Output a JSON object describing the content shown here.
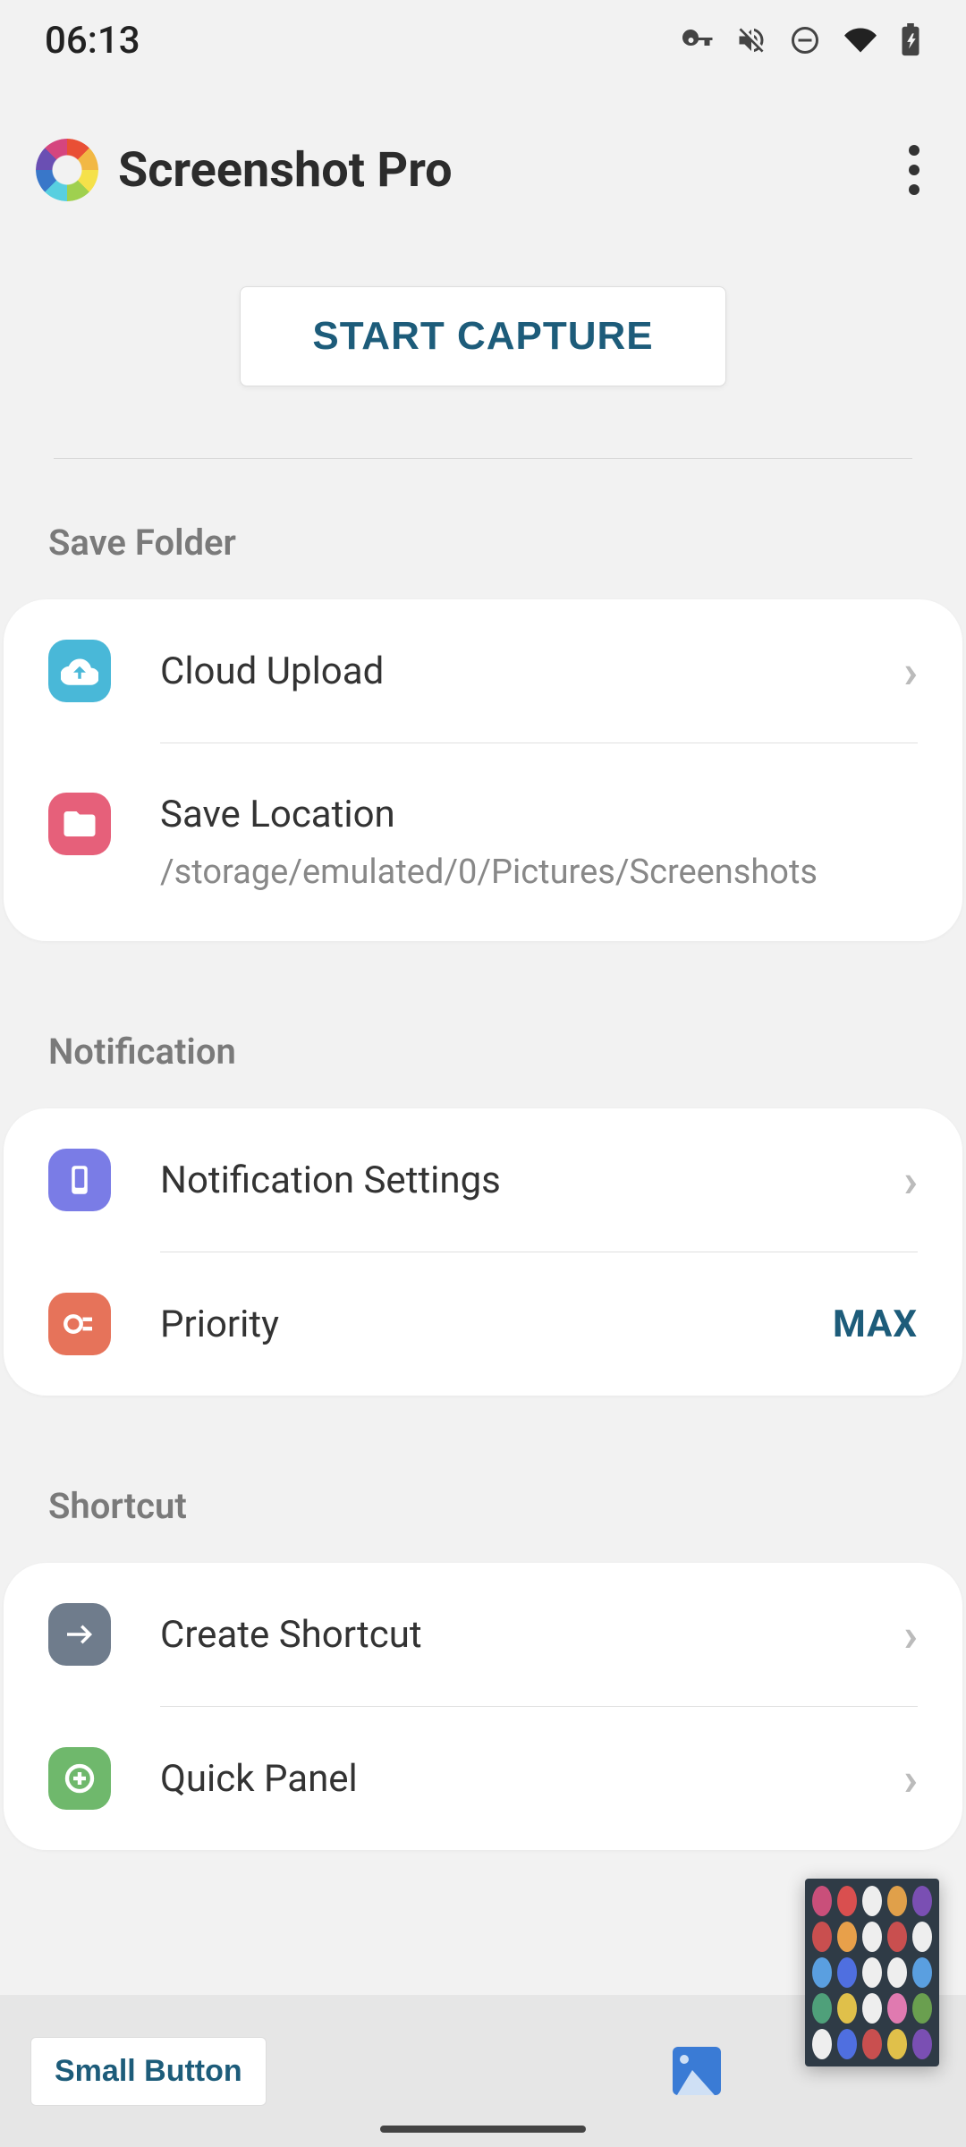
{
  "statusbar": {
    "time": "06:13"
  },
  "header": {
    "title": "Screenshot Pro"
  },
  "capture": {
    "label": "START CAPTURE"
  },
  "sections": {
    "save_folder": {
      "header": "Save Folder",
      "cloud_upload": {
        "label": "Cloud Upload"
      },
      "save_location": {
        "label": "Save Location",
        "value": "/storage/emulated/0/Pictures/Screenshots"
      }
    },
    "notification": {
      "header": "Notification",
      "settings": {
        "label": "Notification Settings"
      },
      "priority": {
        "label": "Priority",
        "value": "MAX"
      }
    },
    "shortcut": {
      "header": "Shortcut",
      "create": {
        "label": "Create Shortcut"
      },
      "quick_panel": {
        "label": "Quick Panel"
      }
    }
  },
  "bottom": {
    "small_button": "Small Button"
  },
  "colors": {
    "accent": "#1d5c7a",
    "icon_cloud": "#49b8d8",
    "icon_folder": "#e6607a",
    "icon_notif": "#7a7ce6",
    "icon_priority": "#e6735a",
    "icon_shortcut": "#6f7c8c",
    "icon_quickpanel": "#6fb86c"
  }
}
